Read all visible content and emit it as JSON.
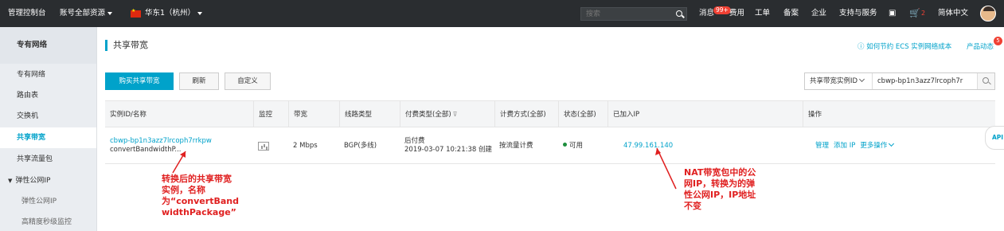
{
  "topbar": {
    "console": "管理控制台",
    "account": "账号全部资源",
    "region": "华东1（杭州）",
    "search_placeholder": "搜索",
    "messages": "消息",
    "messages_badge": "99+",
    "fees": "费用",
    "tickets": "工单",
    "beian": "备案",
    "enterprise": "企业",
    "support": "支持与服务",
    "cart_badge": "2",
    "language": "简体中文"
  },
  "sidebar": {
    "title": "专有网络",
    "items": [
      "专有网络",
      "路由表",
      "交换机",
      "共享带宽",
      "共享流量包",
      "弹性公网IP",
      "弹性公网IP",
      "高精度秒级监控"
    ]
  },
  "main": {
    "title": "共享带宽",
    "help_link": "如何节约 ECS 实例网络成本",
    "dynamics_link": "产品动态",
    "dynamics_badge": "5",
    "buttons": {
      "buy": "购买共享带宽",
      "refresh": "刷新",
      "customize": "自定义"
    },
    "filter": {
      "select": "共享带宽实例ID",
      "value": "cbwp-bp1n3azz7lrcoph7r"
    },
    "columns": [
      "实例ID/名称",
      "监控",
      "带宽",
      "线路类型",
      "付费类型(全部)",
      "计费方式(全部)",
      "状态(全部)",
      "已加入IP",
      "操作"
    ],
    "row": {
      "id": "cbwp-bp1n3azz7lrcoph7rrkpw",
      "name": "convertBandwidthP...",
      "bandwidth": "2 Mbps",
      "line": "BGP(多线)",
      "pay_type": "后付费",
      "created": "2019-03-07 10:21:38 创建",
      "billing": "按流量计费",
      "status": "可用",
      "ip": "47.99.161.140",
      "ops": [
        "管理",
        "添加 IP",
        "更多操作"
      ]
    }
  },
  "annotations": {
    "left": "转换后的共享带宽\n实例，名称\n为“convertBand\nwidthPackage”",
    "right": "NAT带宽包中的公\n网IP，转换为的弹\n性公网IP，IP地址\n不变"
  },
  "api_tab": "API",
  "colors": {
    "accent": "#00a2ca",
    "topbar": "#2a2d30",
    "annotation": "#e02020"
  }
}
